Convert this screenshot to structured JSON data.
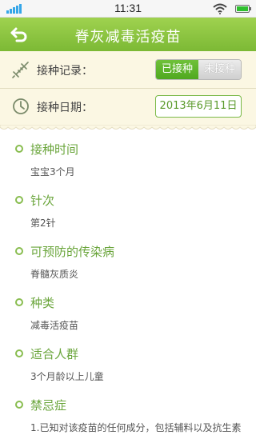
{
  "status_bar": {
    "time": "11:31"
  },
  "header": {
    "title": "脊灰减毒活疫苗"
  },
  "record": {
    "label": "接种记录：",
    "toggle_on": "已接种",
    "toggle_off": "未接种"
  },
  "date": {
    "label": "接种日期：",
    "value": "2013年6月11日"
  },
  "details": [
    {
      "heading": "接种时间",
      "value": "宝宝3个月"
    },
    {
      "heading": "针次",
      "value": "第2针"
    },
    {
      "heading": "可预防的传染病",
      "value": "脊髓灰质炎"
    },
    {
      "heading": "种类",
      "value": "减毒活疫苗"
    },
    {
      "heading": "适合人群",
      "value": "3个月龄以上儿童"
    },
    {
      "heading": "禁忌症",
      "value": "1.已知对该疫苗的任何成分，包括辅料以及抗生素"
    }
  ],
  "colors": {
    "accent": "#7cb935",
    "panel": "#fbf7e3"
  }
}
